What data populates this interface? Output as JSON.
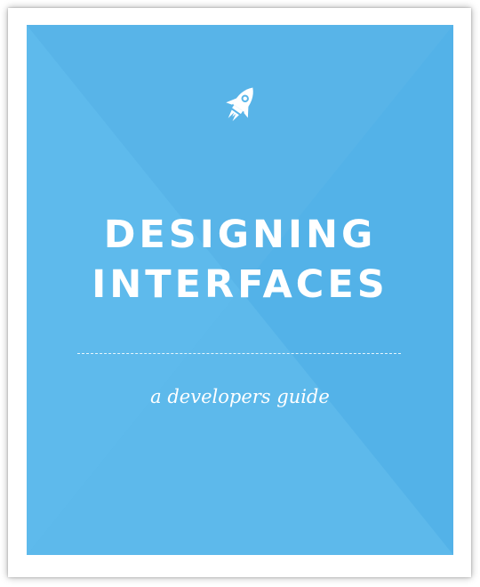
{
  "cover": {
    "icon": "rocket-icon",
    "title_line1": "DESIGNING",
    "title_line2": "INTERFACES",
    "subtitle": "a developers guide",
    "colors": {
      "background": "#5bb7ea",
      "text": "#ffffff"
    }
  }
}
